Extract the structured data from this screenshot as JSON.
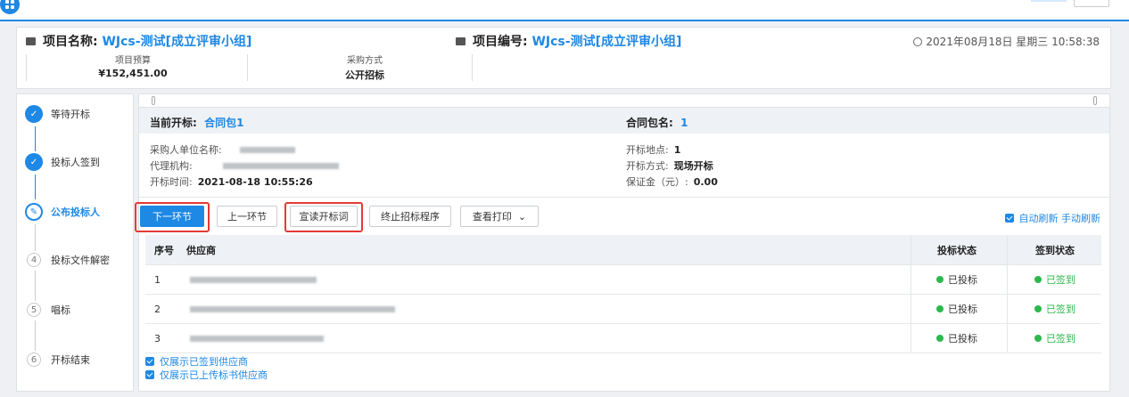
{
  "header": {
    "project_name_label": "项目名称:",
    "project_name": "WJcs-测试[成立评审小组]",
    "project_no_label": "项目编号:",
    "project_no": "WJcs-测试[成立评审小组]",
    "datetime": "2021年08月18日 星期三 10:58:38",
    "budget_label": "项目预算",
    "budget_value": "¥152,451.00",
    "method_label": "采购方式",
    "method_value": "公开招标"
  },
  "steps": [
    {
      "index": "✓",
      "label": "等待开标",
      "state": "done"
    },
    {
      "index": "✓",
      "label": "投标人签到",
      "state": "done"
    },
    {
      "index": "✎",
      "label": "公布投标人",
      "state": "current"
    },
    {
      "index": "4",
      "label": "投标文件解密",
      "state": "todo"
    },
    {
      "index": "5",
      "label": "唱标",
      "state": "todo"
    },
    {
      "index": "6",
      "label": "开标结束",
      "state": "todo"
    }
  ],
  "info": {
    "current_label": "当前开标:",
    "current_value": "合同包1",
    "package_label": "合同包名:",
    "package_value": "1",
    "buyer_label": "采购人单位名称:",
    "agency_label": "代理机构:",
    "open_time_label": "开标时间:",
    "open_time_value": "2021-08-18 10:55:26",
    "location_label": "开标地点:",
    "location_value": "1",
    "open_method_label": "开标方式:",
    "open_method_value": "现场开标",
    "deposit_label": "保证金（元）:",
    "deposit_value": "0.00"
  },
  "actions": {
    "next": "下一环节",
    "prev": "上一环节",
    "read_speech": "宣读开标词",
    "terminate": "终止招标程序",
    "print": "查看打印",
    "auto_refresh": "自动刷新",
    "manual_refresh": "手动刷新"
  },
  "table": {
    "headers": {
      "no": "序号",
      "supplier": "供应商",
      "bid_status": "投标状态",
      "sign_status": "签到状态"
    },
    "rows": [
      {
        "no": "1",
        "bid_status": "已投标",
        "sign_status": "已签到"
      },
      {
        "no": "2",
        "bid_status": "已投标",
        "sign_status": "已签到"
      },
      {
        "no": "3",
        "bid_status": "已投标",
        "sign_status": "已签到"
      }
    ]
  },
  "filters": {
    "signed_only": "仅展示已签到供应商",
    "uploaded_only": "仅展示已上传标书供应商"
  },
  "colors": {
    "accent": "#1e88e5",
    "success": "#2db84d",
    "highlight": "#e53935"
  }
}
